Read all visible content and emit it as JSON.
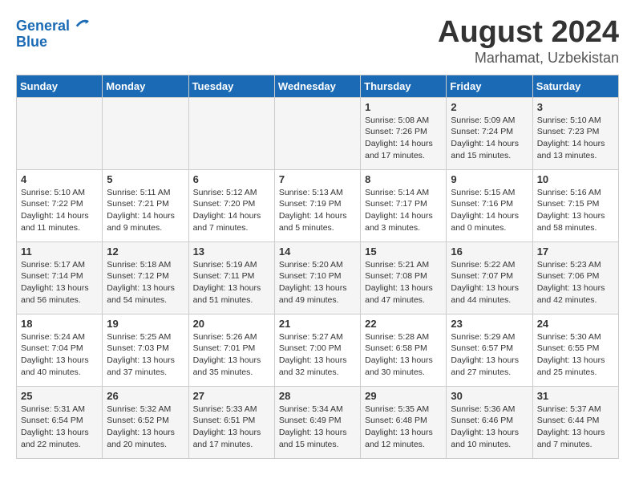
{
  "logo": {
    "line1": "General",
    "line2": "Blue"
  },
  "title": "August 2024",
  "location": "Marhamat, Uzbekistan",
  "weekdays": [
    "Sunday",
    "Monday",
    "Tuesday",
    "Wednesday",
    "Thursday",
    "Friday",
    "Saturday"
  ],
  "weeks": [
    [
      {
        "day": "",
        "info": ""
      },
      {
        "day": "",
        "info": ""
      },
      {
        "day": "",
        "info": ""
      },
      {
        "day": "",
        "info": ""
      },
      {
        "day": "1",
        "info": "Sunrise: 5:08 AM\nSunset: 7:26 PM\nDaylight: 14 hours\nand 17 minutes."
      },
      {
        "day": "2",
        "info": "Sunrise: 5:09 AM\nSunset: 7:24 PM\nDaylight: 14 hours\nand 15 minutes."
      },
      {
        "day": "3",
        "info": "Sunrise: 5:10 AM\nSunset: 7:23 PM\nDaylight: 14 hours\nand 13 minutes."
      }
    ],
    [
      {
        "day": "4",
        "info": "Sunrise: 5:10 AM\nSunset: 7:22 PM\nDaylight: 14 hours\nand 11 minutes."
      },
      {
        "day": "5",
        "info": "Sunrise: 5:11 AM\nSunset: 7:21 PM\nDaylight: 14 hours\nand 9 minutes."
      },
      {
        "day": "6",
        "info": "Sunrise: 5:12 AM\nSunset: 7:20 PM\nDaylight: 14 hours\nand 7 minutes."
      },
      {
        "day": "7",
        "info": "Sunrise: 5:13 AM\nSunset: 7:19 PM\nDaylight: 14 hours\nand 5 minutes."
      },
      {
        "day": "8",
        "info": "Sunrise: 5:14 AM\nSunset: 7:17 PM\nDaylight: 14 hours\nand 3 minutes."
      },
      {
        "day": "9",
        "info": "Sunrise: 5:15 AM\nSunset: 7:16 PM\nDaylight: 14 hours\nand 0 minutes."
      },
      {
        "day": "10",
        "info": "Sunrise: 5:16 AM\nSunset: 7:15 PM\nDaylight: 13 hours\nand 58 minutes."
      }
    ],
    [
      {
        "day": "11",
        "info": "Sunrise: 5:17 AM\nSunset: 7:14 PM\nDaylight: 13 hours\nand 56 minutes."
      },
      {
        "day": "12",
        "info": "Sunrise: 5:18 AM\nSunset: 7:12 PM\nDaylight: 13 hours\nand 54 minutes."
      },
      {
        "day": "13",
        "info": "Sunrise: 5:19 AM\nSunset: 7:11 PM\nDaylight: 13 hours\nand 51 minutes."
      },
      {
        "day": "14",
        "info": "Sunrise: 5:20 AM\nSunset: 7:10 PM\nDaylight: 13 hours\nand 49 minutes."
      },
      {
        "day": "15",
        "info": "Sunrise: 5:21 AM\nSunset: 7:08 PM\nDaylight: 13 hours\nand 47 minutes."
      },
      {
        "day": "16",
        "info": "Sunrise: 5:22 AM\nSunset: 7:07 PM\nDaylight: 13 hours\nand 44 minutes."
      },
      {
        "day": "17",
        "info": "Sunrise: 5:23 AM\nSunset: 7:06 PM\nDaylight: 13 hours\nand 42 minutes."
      }
    ],
    [
      {
        "day": "18",
        "info": "Sunrise: 5:24 AM\nSunset: 7:04 PM\nDaylight: 13 hours\nand 40 minutes."
      },
      {
        "day": "19",
        "info": "Sunrise: 5:25 AM\nSunset: 7:03 PM\nDaylight: 13 hours\nand 37 minutes."
      },
      {
        "day": "20",
        "info": "Sunrise: 5:26 AM\nSunset: 7:01 PM\nDaylight: 13 hours\nand 35 minutes."
      },
      {
        "day": "21",
        "info": "Sunrise: 5:27 AM\nSunset: 7:00 PM\nDaylight: 13 hours\nand 32 minutes."
      },
      {
        "day": "22",
        "info": "Sunrise: 5:28 AM\nSunset: 6:58 PM\nDaylight: 13 hours\nand 30 minutes."
      },
      {
        "day": "23",
        "info": "Sunrise: 5:29 AM\nSunset: 6:57 PM\nDaylight: 13 hours\nand 27 minutes."
      },
      {
        "day": "24",
        "info": "Sunrise: 5:30 AM\nSunset: 6:55 PM\nDaylight: 13 hours\nand 25 minutes."
      }
    ],
    [
      {
        "day": "25",
        "info": "Sunrise: 5:31 AM\nSunset: 6:54 PM\nDaylight: 13 hours\nand 22 minutes."
      },
      {
        "day": "26",
        "info": "Sunrise: 5:32 AM\nSunset: 6:52 PM\nDaylight: 13 hours\nand 20 minutes."
      },
      {
        "day": "27",
        "info": "Sunrise: 5:33 AM\nSunset: 6:51 PM\nDaylight: 13 hours\nand 17 minutes."
      },
      {
        "day": "28",
        "info": "Sunrise: 5:34 AM\nSunset: 6:49 PM\nDaylight: 13 hours\nand 15 minutes."
      },
      {
        "day": "29",
        "info": "Sunrise: 5:35 AM\nSunset: 6:48 PM\nDaylight: 13 hours\nand 12 minutes."
      },
      {
        "day": "30",
        "info": "Sunrise: 5:36 AM\nSunset: 6:46 PM\nDaylight: 13 hours\nand 10 minutes."
      },
      {
        "day": "31",
        "info": "Sunrise: 5:37 AM\nSunset: 6:44 PM\nDaylight: 13 hours\nand 7 minutes."
      }
    ]
  ]
}
